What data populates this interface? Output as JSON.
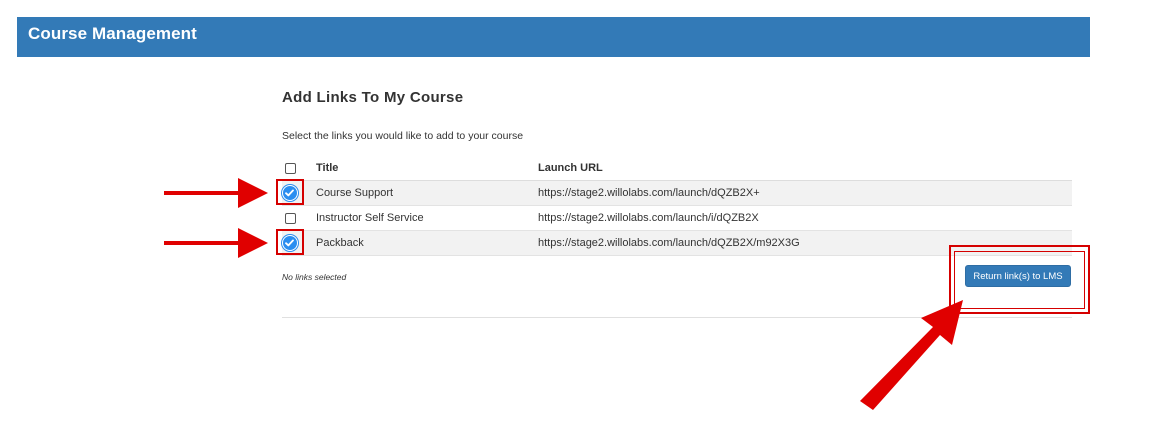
{
  "header": {
    "title": "Course Management"
  },
  "page": {
    "heading": "Add Links To My Course",
    "instructions": "Select the links you would like to add to your course"
  },
  "table": {
    "columns": {
      "title": "Title",
      "launch_url": "Launch URL"
    },
    "rows": [
      {
        "title": "Course Support",
        "launch_url": "https://stage2.willolabs.com/launch/dQZB2X+",
        "checked": true
      },
      {
        "title": "Instructor Self Service",
        "launch_url": "https://stage2.willolabs.com/launch/i/dQZB2X",
        "checked": false
      },
      {
        "title": "Packback",
        "launch_url": "https://stage2.willolabs.com/launch/dQZB2X/m92X3G",
        "checked": true
      }
    ]
  },
  "status_text": "No links selected",
  "return_button_label": "Return link(s) to LMS",
  "colors": {
    "header_bg": "#337ab7",
    "checked": "#2b8ef0",
    "annotation_red": "#e00000",
    "row_shade": "#f2f2f2"
  },
  "icons": {
    "checked": "check-circle-icon",
    "unchecked": "checkbox-icon",
    "annotation": "arrow-icon"
  }
}
